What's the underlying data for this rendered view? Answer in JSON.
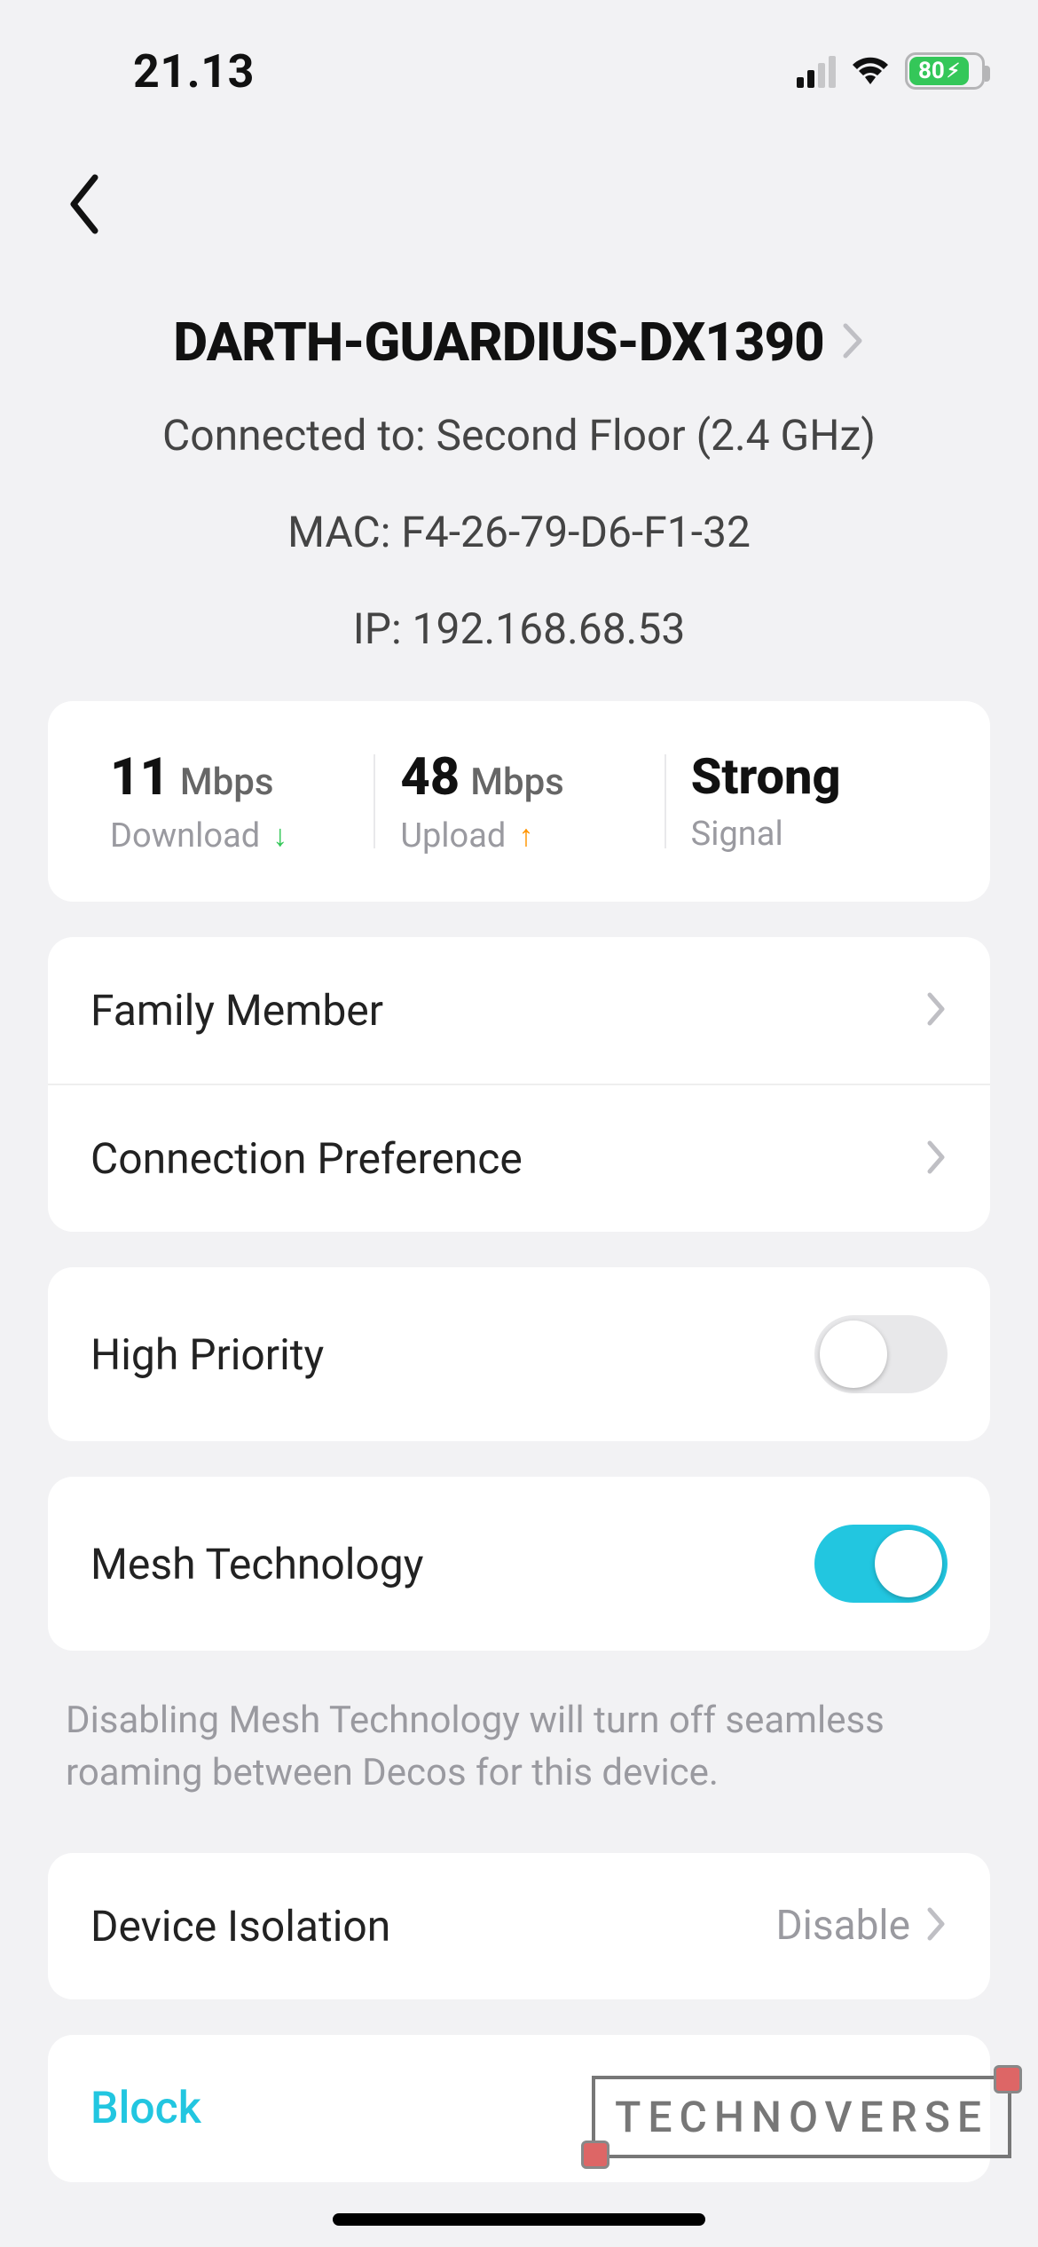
{
  "status": {
    "time": "21.13",
    "battery_pct": "80"
  },
  "device": {
    "name": "DARTH-GUARDIUS-DX1390",
    "connected_to": "Connected to: Second Floor (2.4 GHz)",
    "mac": "MAC: F4-26-79-D6-F1-32",
    "ip": "IP: 192.168.68.53"
  },
  "stats": {
    "download_value": "11",
    "download_unit": "Mbps",
    "download_label": "Download",
    "upload_value": "48",
    "upload_unit": "Mbps",
    "upload_label": "Upload",
    "signal_value": "Strong",
    "signal_label": "Signal"
  },
  "rows": {
    "family_member": "Family Member",
    "connection_preference": "Connection Preference",
    "high_priority": "High Priority",
    "mesh_technology": "Mesh Technology",
    "mesh_footnote": "Disabling Mesh Technology will turn off seamless roaming between Decos for this device.",
    "device_isolation_label": "Device Isolation",
    "device_isolation_value": "Disable",
    "block": "Block"
  },
  "toggles": {
    "high_priority_on": false,
    "mesh_on": true
  },
  "watermark": "TECHNOVERSE"
}
